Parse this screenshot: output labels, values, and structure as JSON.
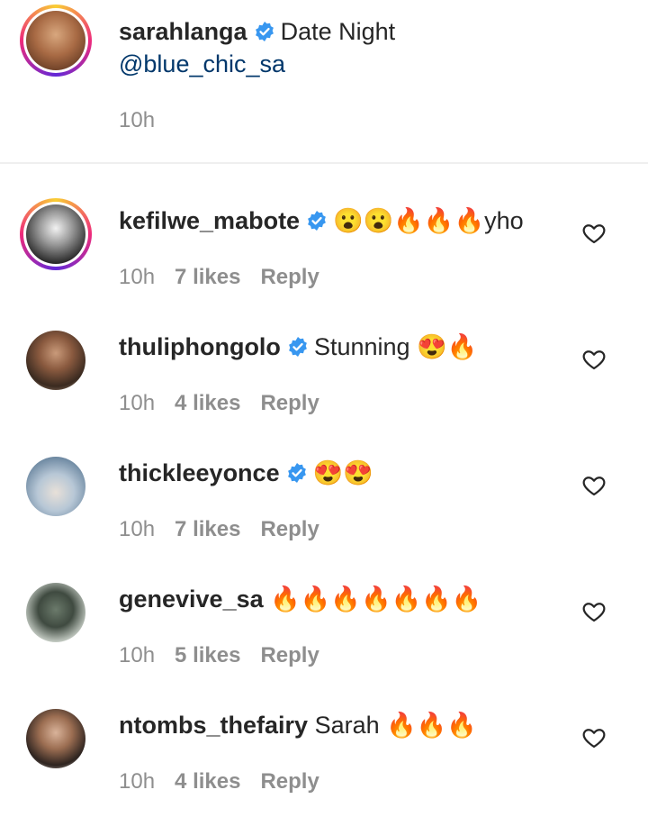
{
  "caption": {
    "username": "sarahlanga",
    "text": "Date Night",
    "mention": "@blue_chic_sa",
    "time": "10h"
  },
  "reply_label": "Reply",
  "comments": [
    {
      "username": "kefilwe_mabote",
      "text": "😮😮🔥🔥🔥yho",
      "time": "10h",
      "likes": "7 likes",
      "verified": true,
      "story_ring": true
    },
    {
      "username": "thuliphongolo",
      "text": "Stunning 😍🔥",
      "time": "10h",
      "likes": "4 likes",
      "verified": true,
      "story_ring": false
    },
    {
      "username": "thickleeyonce",
      "text": "😍😍",
      "time": "10h",
      "likes": "7 likes",
      "verified": true,
      "story_ring": false
    },
    {
      "username": "genevive_sa",
      "text": "🔥🔥🔥🔥🔥🔥🔥",
      "time": "10h",
      "likes": "5 likes",
      "verified": false,
      "story_ring": false
    },
    {
      "username": "ntombs_thefairy",
      "text": "Sarah 🔥🔥🔥",
      "time": "10h",
      "likes": "4 likes",
      "verified": false,
      "story_ring": false
    }
  ],
  "icons": {
    "verified": "verified-badge-icon",
    "like": "heart-outline-icon"
  },
  "colors": {
    "mention": "#00376b",
    "verified": "#3897f0",
    "meta": "#8e8e8e"
  }
}
